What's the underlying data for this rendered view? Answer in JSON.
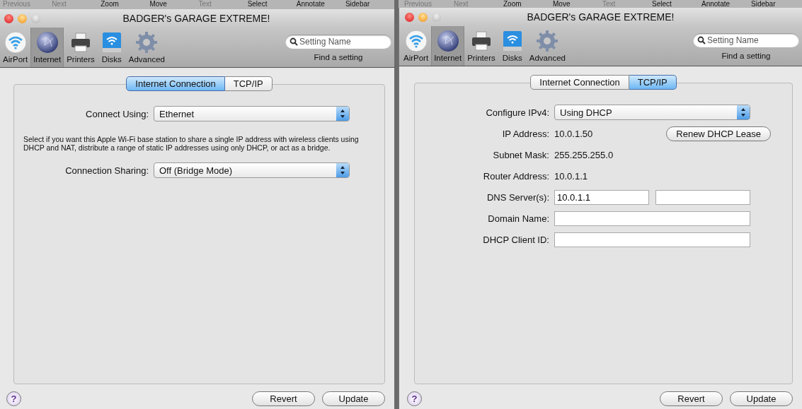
{
  "windows": [
    {
      "background_toolbar": [
        {
          "label": "Previous",
          "disabled": true
        },
        {
          "label": "Next",
          "disabled": true
        },
        {
          "label": "Zoom",
          "disabled": false
        },
        {
          "label": "Move",
          "disabled": false
        },
        {
          "label": "Text",
          "disabled": true
        },
        {
          "label": "Select",
          "disabled": false
        },
        {
          "label": "Annotate",
          "disabled": false
        },
        {
          "label": "Sidebar",
          "disabled": false
        }
      ],
      "title": "BADGER's GARAGE EXTREME!",
      "toolbar": [
        {
          "label": "AirPort",
          "selected": false
        },
        {
          "label": "Internet",
          "selected": true
        },
        {
          "label": "Printers",
          "selected": false
        },
        {
          "label": "Disks",
          "selected": false
        },
        {
          "label": "Advanced",
          "selected": false
        }
      ],
      "search": {
        "placeholder": "Setting Name",
        "caption": "Find a setting"
      },
      "tabs": [
        {
          "label": "Internet Connection",
          "selected": true
        },
        {
          "label": "TCP/IP",
          "selected": false
        }
      ],
      "rows": [
        {
          "kind": "popup",
          "label": "Connect Using:",
          "value": "Ethernet"
        },
        {
          "kind": "note",
          "text": "Select if you want this Apple Wi-Fi base station to share a single IP address with wireless clients using DHCP and NAT, distribute a range of static IP addresses using only DHCP, or act as a bridge."
        },
        {
          "kind": "popup",
          "label": "Connection Sharing:",
          "value": "Off (Bridge Mode)"
        }
      ],
      "help": "?",
      "buttons": [
        "Revert",
        "Update"
      ]
    },
    {
      "background_toolbar": [
        {
          "label": "Previous",
          "disabled": true
        },
        {
          "label": "Next",
          "disabled": true
        },
        {
          "label": "Zoom",
          "disabled": false
        },
        {
          "label": "Move",
          "disabled": false
        },
        {
          "label": "Text",
          "disabled": true
        },
        {
          "label": "Select",
          "disabled": false
        },
        {
          "label": "Annotate",
          "disabled": false
        },
        {
          "label": "Sidebar",
          "disabled": false
        }
      ],
      "title": "BADGER's GARAGE EXTREME!",
      "toolbar": [
        {
          "label": "AirPort",
          "selected": false
        },
        {
          "label": "Internet",
          "selected": true
        },
        {
          "label": "Printers",
          "selected": false
        },
        {
          "label": "Disks",
          "selected": false
        },
        {
          "label": "Advanced",
          "selected": false
        }
      ],
      "search": {
        "placeholder": "Setting Name",
        "caption": "Find a setting"
      },
      "tabs": [
        {
          "label": "Internet Connection",
          "selected": false
        },
        {
          "label": "TCP/IP",
          "selected": true
        }
      ],
      "rows": [
        {
          "kind": "popup",
          "label": "Configure IPv4:",
          "value": "Using DHCP"
        },
        {
          "kind": "value",
          "label": "IP Address:",
          "value": "10.0.1.50",
          "button": "Renew DHCP Lease"
        },
        {
          "kind": "value",
          "label": "Subnet Mask:",
          "value": "255.255.255.0"
        },
        {
          "kind": "value",
          "label": "Router Address:",
          "value": "10.0.1.1"
        },
        {
          "kind": "two_fields",
          "label": "DNS Server(s):",
          "value": "10.0.1.1"
        },
        {
          "kind": "field",
          "label": "Domain Name:"
        },
        {
          "kind": "field",
          "label": "DHCP Client ID:"
        }
      ],
      "help": "?",
      "buttons": [
        "Revert",
        "Update"
      ]
    }
  ]
}
